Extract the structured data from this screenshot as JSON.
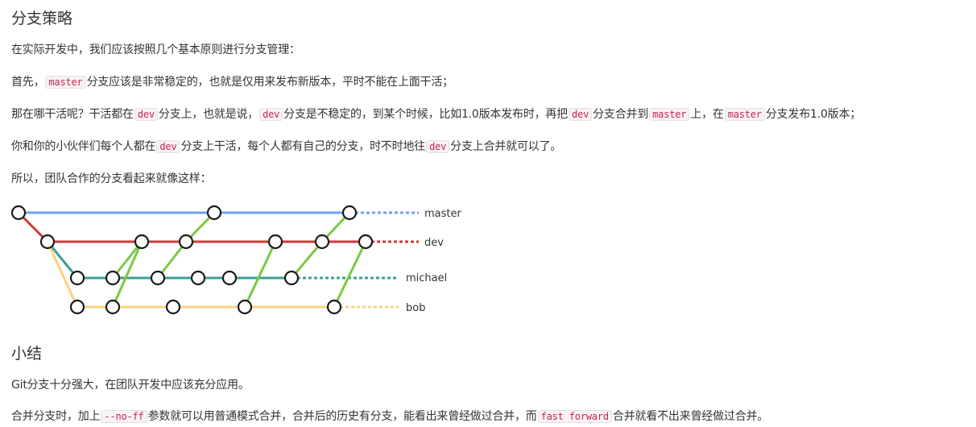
{
  "section1": {
    "title": "分支策略",
    "intro": "在实际开发中，我们应该按照几个基本原则进行分支管理：",
    "line1": {
      "t1": "首先，",
      "c1": "master",
      "t2": "分支应该是非常稳定的，也就是仅用来发布新版本，平时不能在上面干活；"
    },
    "line2": {
      "t1": "那在哪干活呢？干活都在",
      "c1": "dev",
      "t2": "分支上，也就是说，",
      "c2": "dev",
      "t3": "分支是不稳定的，到某个时候，比如1.0版本发布时，再把",
      "c3": "dev",
      "t4": "分支合并到",
      "c4": "master",
      "t5": "上，在",
      "c5": "master",
      "t6": "分支发布1.0版本；"
    },
    "line3": {
      "t1": "你和你的小伙伴们每个人都在",
      "c1": "dev",
      "t2": "分支上干活，每个人都有自己的分支，时不时地往",
      "c2": "dev",
      "t3": "分支上合并就可以了。"
    },
    "line4": "所以，团队合作的分支看起来就像这样："
  },
  "diagram": {
    "branches": [
      "master",
      "dev",
      "michael",
      "bob"
    ],
    "colors": {
      "master": "#6fa0ee",
      "dev": "#cc3b33",
      "michael": "#3a9e9a",
      "bob": "#fbd37c",
      "merge": "#7ac943"
    }
  },
  "section2": {
    "title": "小结",
    "line1": "Git分支十分强大，在团队开发中应该充分应用。",
    "line2": {
      "t1": "合并分支时，加上",
      "c1": "--no-ff",
      "t2": "参数就可以用普通模式合并，合并后的历史有分支，能看出来曾经做过合并，而",
      "c2": "fast forward",
      "t3": "合并就看不出来曾经做过合并。"
    }
  }
}
